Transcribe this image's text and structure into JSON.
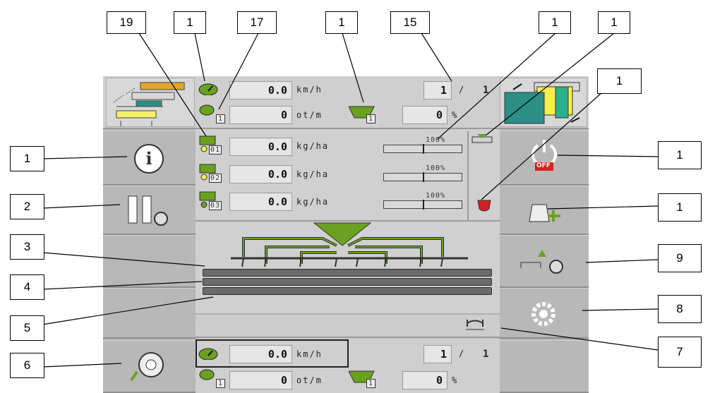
{
  "header": {
    "speed_value": "0.0",
    "speed_unit": "km/h",
    "rpm_value": "0",
    "rpm_unit": "ot/m",
    "section_from": "1",
    "section_to": "1",
    "hopper_value": "0",
    "hopper_unit": "%",
    "hopper_index": "1",
    "rpm_index": "1"
  },
  "metering": [
    {
      "value": "0.0",
      "unit": "kg/ha",
      "percent": "100%",
      "index": "01"
    },
    {
      "value": "0.0",
      "unit": "kg/ha",
      "percent": "100%",
      "index": "02"
    },
    {
      "value": "0.0",
      "unit": "kg/ha",
      "percent": "100%",
      "index": "03"
    }
  ],
  "footer": {
    "speed_value": "0.0",
    "speed_unit": "km/h",
    "rpm_value": "0",
    "rpm_unit": "ot/m",
    "section_from": "1",
    "section_to": "1",
    "hopper_value": "0",
    "hopper_unit": "%",
    "hopper_index": "1",
    "rpm_index": "1"
  },
  "right_buttons": {
    "off_label": "OFF"
  },
  "callouts": {
    "top": [
      "19",
      "1",
      "17",
      "1",
      "15",
      "1",
      "1",
      "1"
    ],
    "left": [
      "1",
      "2",
      "3",
      "4",
      "5",
      "6"
    ],
    "right": [
      "1",
      "1",
      "9",
      "8",
      "7"
    ]
  },
  "colors": {
    "accent_green": "#6aa121",
    "roller_gray": "#6b6b6b",
    "off_red": "#d42020"
  }
}
